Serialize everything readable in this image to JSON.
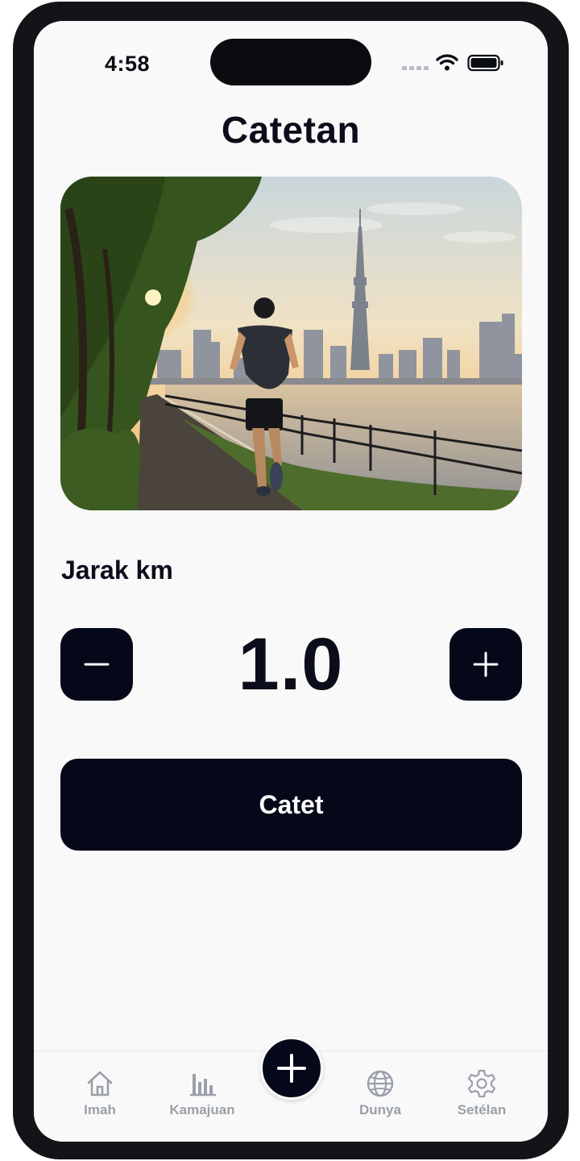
{
  "status_bar": {
    "time": "4:58"
  },
  "page": {
    "title": "Catetan"
  },
  "distance": {
    "label": "Jarak km",
    "value": "1.0"
  },
  "save_button": {
    "label": "Catet"
  },
  "tabs": [
    {
      "label": "Imah",
      "icon": "home-icon"
    },
    {
      "label": "Kamajuan",
      "icon": "bar-chart-icon"
    },
    {
      "label": "Dunya",
      "icon": "globe-icon"
    },
    {
      "label": "Setélan",
      "icon": "gear-icon"
    }
  ],
  "fab": {
    "icon": "plus-icon"
  },
  "colors": {
    "primary": "#050818",
    "background": "#f9f9f9",
    "tab_inactive": "#9aa0a9"
  }
}
